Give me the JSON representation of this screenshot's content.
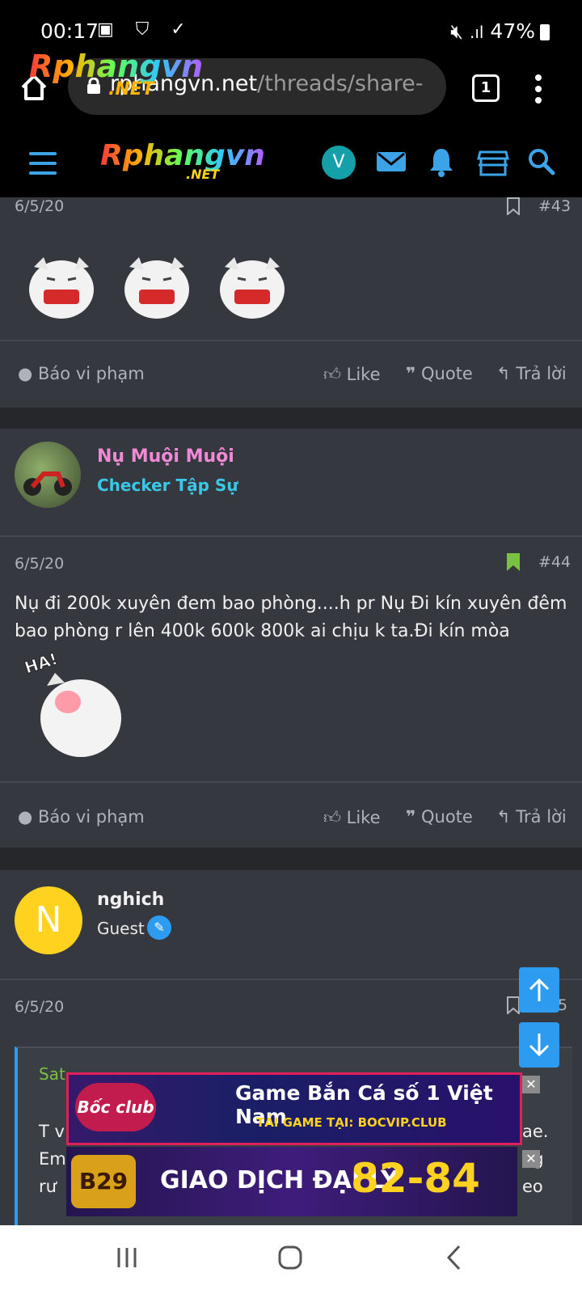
{
  "status_bar": {
    "time": "00:17",
    "battery": "47%"
  },
  "browser": {
    "url_host": "rphangvn.net",
    "url_path": "/threads/share-",
    "tab_count": "1"
  },
  "site": {
    "logo_main": "Rphangvn",
    "logo_sub": ".NET",
    "user_initial": "V"
  },
  "post43": {
    "date": "6/5/20",
    "number": "#43"
  },
  "actions": {
    "report": "Báo vi phạm",
    "like": "Like",
    "quote": "Quote",
    "reply": "Trả lời"
  },
  "post44": {
    "author": "Nụ Muội Muội",
    "rank": "Checker Tập Sự",
    "date": "6/5/20",
    "number": "#44",
    "text_line1": "Nụ đi 200k xuyên đem bao phòng....h pr Nụ Đi kín xuyên đêm",
    "text_line2": "bao phòng r lên 400k 600k 800k ai chịu k ta.Đi kín mòa",
    "sticker_text": "HA!"
  },
  "post45": {
    "author": "nghich",
    "avatar_initial": "N",
    "role": "Guest",
    "date": "6/5/20",
    "number_partial": "5",
    "quote_partial_name": "Sat",
    "quote_line1_left": "T v",
    "quote_line1_right": "ae.",
    "quote_line2_left": "Em",
    "quote_line2_right": "ng",
    "quote_line3_left": "rư",
    "quote_line3_right": "eo"
  },
  "ads": {
    "banner1_brand": "Bốc club",
    "banner1_headline": "Game Bắn Cá số 1 Việt Nam",
    "banner1_sub": "TẢI GAME TẠI: BOCVIP.CLUB",
    "banner2_brand": "B29",
    "banner2_headline": "GIAO DỊCH ĐẠI LÝ",
    "banner2_rate": "82-84"
  },
  "colors": {
    "accent_blue": "#2d9cf0",
    "pink_name": "#f08ad6",
    "cyan_rank": "#3ac7e8",
    "bookmark_green": "#7ac142"
  }
}
